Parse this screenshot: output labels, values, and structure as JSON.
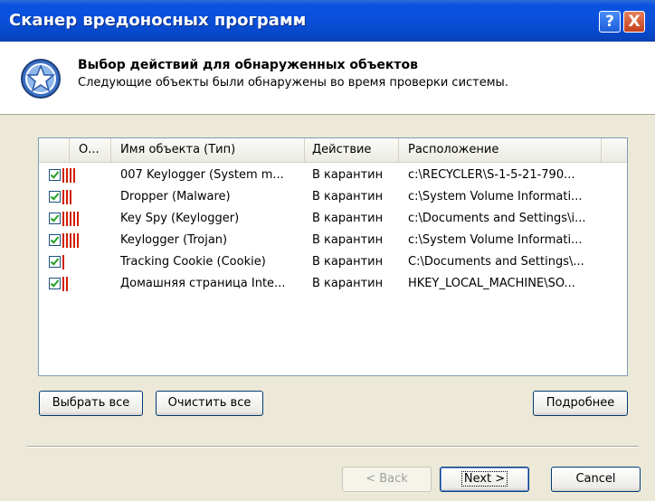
{
  "window": {
    "title": "Сканер вредоносных программ",
    "help_symbol": "?",
    "close_symbol": "X"
  },
  "header": {
    "icon": "star-shield-icon",
    "title": "Выбор действий для обнаруженных объектов",
    "subtitle": "Следующие объекты были обнаружены во время проверки системы."
  },
  "list": {
    "columns": [
      "О...",
      "Имя объекта (Тип)",
      "Действие",
      "Расположение"
    ],
    "rows": [
      {
        "checked": true,
        "severity": 4,
        "name": "007 Keylogger (System m...",
        "action": "В карантин",
        "location": "c:\\RECYCLER\\S-1-5-21-790..."
      },
      {
        "checked": true,
        "severity": 3,
        "name": "Dropper (Malware)",
        "action": "В карантин",
        "location": "c:\\System Volume Informati..."
      },
      {
        "checked": true,
        "severity": 5,
        "name": "Key Spy (Keylogger)",
        "action": "В карантин",
        "location": "c:\\Documents and Settings\\i..."
      },
      {
        "checked": true,
        "severity": 5,
        "name": "Keylogger (Trojan)",
        "action": "В карантин",
        "location": "c:\\System Volume Informati..."
      },
      {
        "checked": true,
        "severity": 1,
        "name": "Tracking Cookie (Cookie)",
        "action": "В карантин",
        "location": "C:\\Documents and Settings\\..."
      },
      {
        "checked": true,
        "severity": 2,
        "name": "Домашняя страница Inte...",
        "action": "В карантин",
        "location": "HKEY_LOCAL_MACHINE\\SO..."
      }
    ]
  },
  "buttons": {
    "select_all": "Выбрать все",
    "clear_all": "Очистить все",
    "details": "Подробнее",
    "back": "< Back",
    "next": "Next >",
    "cancel": "Cancel"
  },
  "colors": {
    "title_bar": "#0a54e3",
    "severity": "#d01f00",
    "check": "#21a121",
    "background": "#ece9d8"
  }
}
